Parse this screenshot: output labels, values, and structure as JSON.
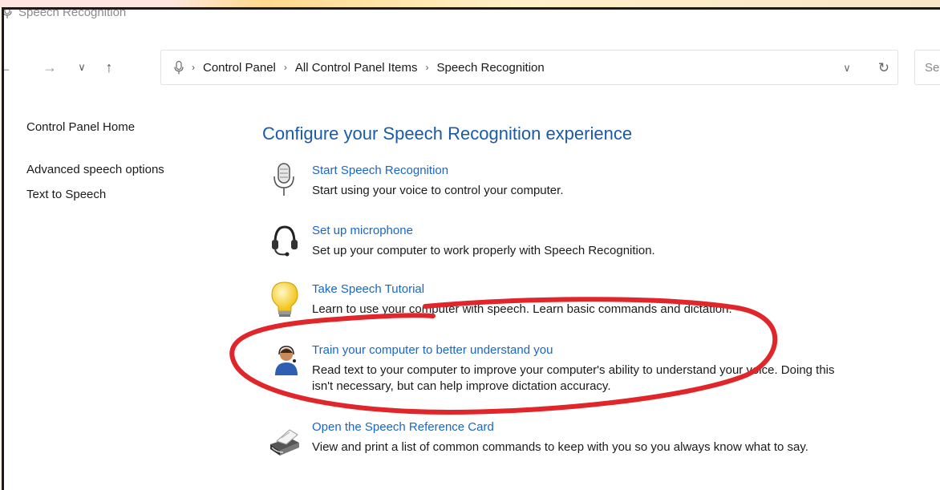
{
  "window": {
    "title": "Speech Recognition"
  },
  "address": {
    "crumbs": [
      "Control Panel",
      "All Control Panel Items",
      "Speech Recognition"
    ],
    "search_placeholder": "Se"
  },
  "left_nav": {
    "home": "Control Panel Home",
    "links": [
      "Advanced speech options",
      "Text to Speech"
    ]
  },
  "main": {
    "heading": "Configure your Speech Recognition experience",
    "items": [
      {
        "icon": "microphone-icon",
        "link": "Start Speech Recognition",
        "desc": "Start using your voice to control your computer."
      },
      {
        "icon": "headset-icon",
        "link": "Set up microphone",
        "desc": "Set up your computer to work properly with Speech Recognition."
      },
      {
        "icon": "lightbulb-icon",
        "link": "Take Speech Tutorial",
        "desc": "Learn to use your computer with speech.  Learn basic commands and dictation."
      },
      {
        "icon": "person-headset-icon",
        "link": "Train your computer to better understand you",
        "desc": "Read text to your computer to improve your computer's ability to understand your voice.  Doing this",
        "desc2": "isn't necessary, but can help improve dictation accuracy."
      },
      {
        "icon": "printer-icon",
        "link": "Open the Speech Reference Card",
        "desc": "View and print a list of common commands to keep with you so you always know what to say."
      }
    ]
  },
  "colors": {
    "link": "#1a66c8",
    "heading": "#1a5aa8",
    "annotation": "#e0262a"
  }
}
